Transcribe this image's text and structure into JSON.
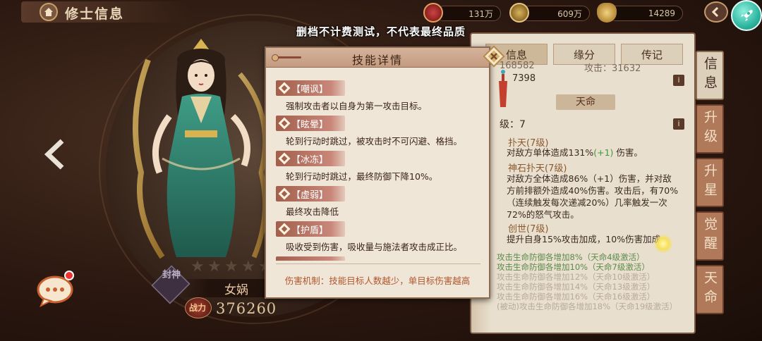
{
  "header": {
    "title": "修士信息",
    "resources": [
      {
        "icon": "ruby-icon",
        "value": "131万"
      },
      {
        "icon": "coin-icon",
        "value": "609万"
      },
      {
        "icon": "gold-ingot-icon",
        "value": "14289"
      }
    ]
  },
  "notice": "删档不计费测试，不代表最终品质",
  "hero": {
    "faction": "封神",
    "name": "女娲",
    "stars": 5,
    "power_label": "战力",
    "power": "376260"
  },
  "panel": {
    "tabs": [
      "信息",
      "缘分",
      "传记"
    ],
    "stat_partial": "168582",
    "stat_partial_right": "攻击：31632",
    "stat_value": "7398",
    "info_btn": "i",
    "heading": "天命",
    "level_line": "级：7",
    "skills": [
      {
        "name": "扑天(7级)",
        "desc": [
          [
            "对敌方单体造成131%",
            ""
          ],
          [
            "(+1)",
            "g"
          ],
          [
            " 伤害。",
            ""
          ]
        ]
      },
      {
        "name": "神石扑天(7级)",
        "desc_lines": [
          "对敌方全体造成86%（+1）伤害，并对敌",
          "方前排额外造成40%伤害。攻击后，有70%",
          "（连续触发每次递减20%）几率触发一次",
          "72%的怒气攻击。"
        ]
      },
      {
        "name": "创世(7级)",
        "desc_lines": [
          "提升自身15%攻击加成，10%伤害加成"
        ]
      }
    ],
    "ming_lines": [
      {
        "text": "攻击生命防御各增加8%（天命4级激活）",
        "active": true
      },
      {
        "text": "攻击生命防御各增加10%（天命7级激活）",
        "active": true
      },
      {
        "text": "攻击生命防御各增加12%（天命10级激活）",
        "active": false
      },
      {
        "text": "攻击生命防御各增加14%（天命13级激活）",
        "active": false
      },
      {
        "text": "攻击生命防御各增加16%（天命16级激活）",
        "active": false
      },
      {
        "text": "(被动)攻击生命防御各增加18%（天命19级激活）",
        "active": false
      }
    ]
  },
  "side_tabs": [
    "信息",
    "升级",
    "升星",
    "觉醒",
    "天命"
  ],
  "popup": {
    "title": "技能详情",
    "skills": [
      {
        "name": "【嘲讽】",
        "desc": "强制攻击者以自身为第一攻击目标。"
      },
      {
        "name": "【眩晕】",
        "desc": "轮到行动时跳过，被攻击时不可闪避、格挡。"
      },
      {
        "name": "【冰冻】",
        "desc": "轮到行动时跳过，最终防御下降10%。"
      },
      {
        "name": "【虚弱】",
        "desc": "最终攻击降低"
      },
      {
        "name": "【护盾】",
        "desc": "吸收受到伤害，吸收量与施法者攻击成正比。"
      }
    ],
    "footer": "伤害机制：技能目标人数越少，单目标伤害越高"
  }
}
